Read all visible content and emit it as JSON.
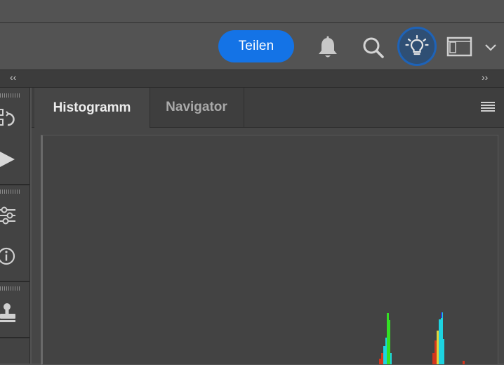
{
  "header": {
    "share_label": "Teilen",
    "icons": [
      "bell-icon",
      "search-icon",
      "lightbulb-icon",
      "workspace-icon",
      "chevron-down-icon"
    ],
    "accent_color": "#1473e6"
  },
  "collapse": {
    "left_label": "‹‹",
    "right_label": "››"
  },
  "left_panel": {
    "icons": [
      "history-icon",
      "play-action-icon",
      "adjustments-icon",
      "info-icon",
      "stamp-icon"
    ]
  },
  "panel": {
    "tabs": [
      {
        "label": "Histogramm",
        "active": true
      },
      {
        "label": "Navigator",
        "active": false
      }
    ],
    "menu_icon": "panel-menu-icon"
  }
}
